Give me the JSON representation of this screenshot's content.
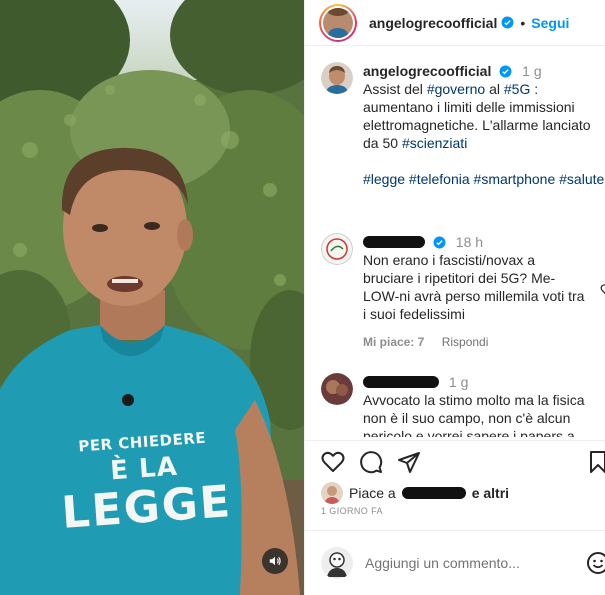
{
  "post": {
    "author": "angelogrecoofficial",
    "follow_label": "Segui",
    "caption_time": "1 g",
    "caption_lines": [
      "Assist del #governo al #5G :",
      "aumentano i limiti delle immissioni",
      "elettromagnetiche. L'allarme lanciato",
      "da 50 #scienziati"
    ],
    "hashtags": "#legge #telefonia #smartphone #salute",
    "shirt_text": {
      "line1": "PER CHIEDERE",
      "line2": "È LA",
      "line3": "LEGGE"
    }
  },
  "comments": [
    {
      "time": "18 h",
      "lines": [
        "Non erano i fascisti/novax a",
        "bruciare i ripetitori dei 5G? Me-",
        "LOW-ni avrà perso millemila voti tra",
        "i suoi fedelissimi"
      ],
      "likes": "Mi piace: 7",
      "reply": "Rispondi"
    },
    {
      "time": "1 g",
      "lines": [
        "Avvocato la stimo molto ma la fisica",
        "non è il suo campo, non c'è alcun",
        "pericolo e vorrei sapere i papers a"
      ]
    }
  ],
  "footer": {
    "likes_prefix": "Piace a",
    "likes_suffix": "e altri",
    "date": "1 GIORNO FA",
    "comment_placeholder": "Aggiungi un commento..."
  },
  "colors": {
    "accent": "#0095f6",
    "hashtag": "#00376b",
    "verified": "#0095f6"
  },
  "icons": [
    "verified-icon",
    "heart-icon",
    "comment-icon",
    "share-icon",
    "bookmark-icon",
    "emoji-icon",
    "audio-icon"
  ]
}
